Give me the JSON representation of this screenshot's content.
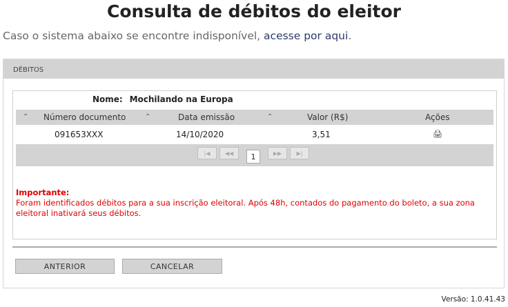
{
  "page": {
    "title": "Consulta de débitos do eleitor",
    "subtitle_text": "Caso o sistema abaixo se encontre indisponível, ",
    "subtitle_link": "acesse por aqui",
    "subtitle_end": "."
  },
  "panel": {
    "header": "DÉBITOS",
    "name_label": "Nome:",
    "name_value": "Mochilando na Europa",
    "columns": [
      "Número documento",
      "Data emissão",
      "Valor (R$)",
      "Ações"
    ],
    "rows": [
      {
        "documento": "091653XXX",
        "data": "14/10/2020",
        "valor": "3,51",
        "acao_icon": "printer-icon"
      }
    ],
    "pager": {
      "current_page": "1"
    },
    "important_title": "Importante:",
    "important_text": "Foram identificados débitos para a sua inscrição eleitoral. Após 48h, contados do pagamento do boleto, a sua zona eleitoral inativará seus débitos."
  },
  "buttons": {
    "previous": "ANTERIOR",
    "cancel": "CANCELAR"
  },
  "footer": {
    "version": "Versão: 1.0.41.43"
  }
}
